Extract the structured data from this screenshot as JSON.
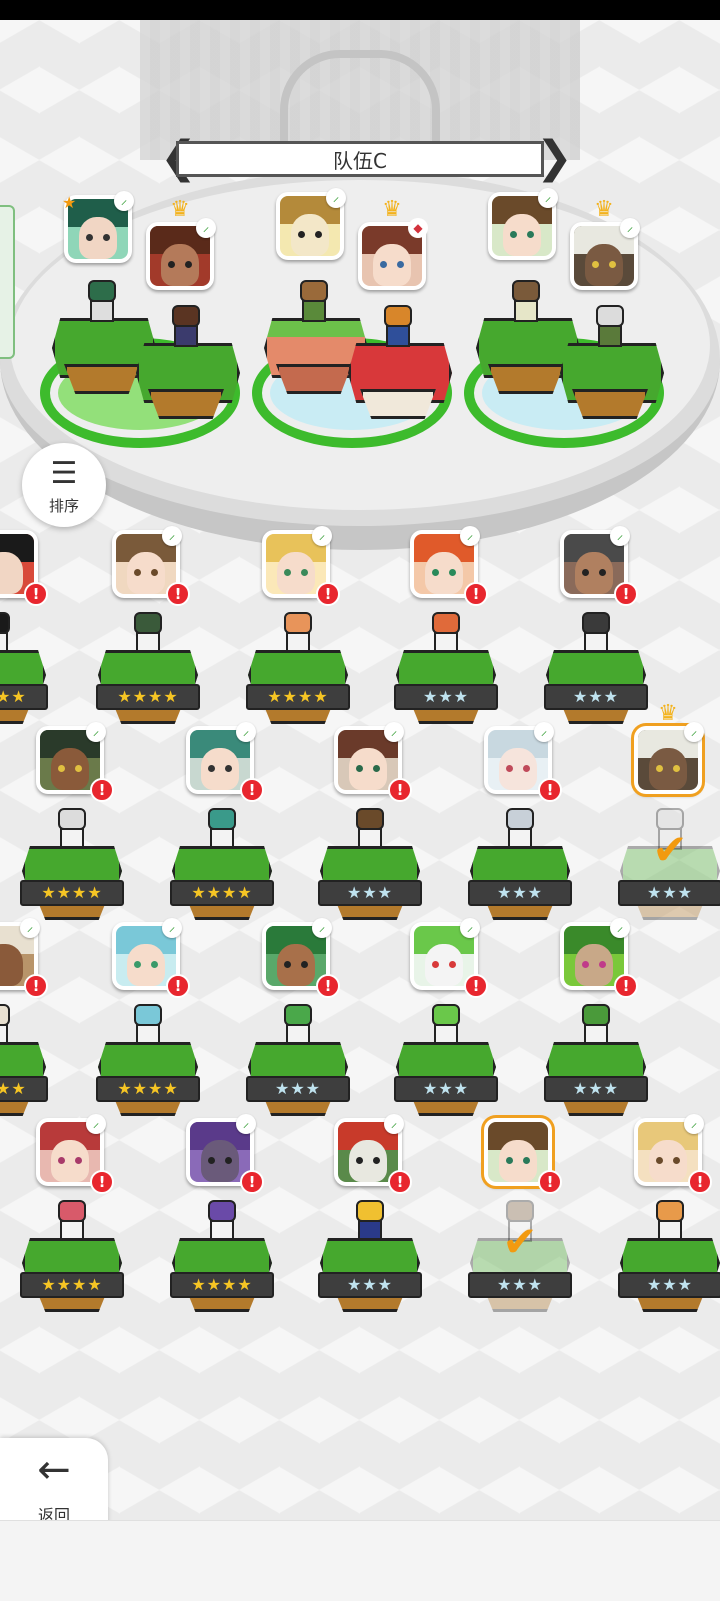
{
  "team": {
    "name": "队伍C"
  },
  "buttons": {
    "sort_label": "排序",
    "back_label": "返回"
  },
  "colors": {
    "crown": "#f3b21c",
    "alert": "#e8262e",
    "gold_star": "#f6c524",
    "silver_star": "#bfe2ee",
    "selection": "#f0a020",
    "grass": "#46a82e"
  },
  "icons": {
    "sort": "sort-descending-icon",
    "back": "arrow-left-icon",
    "leaf": "leaf-icon",
    "alert": "exclamation-badge-icon",
    "crown": "crown-icon",
    "check": "checkmark-icon"
  },
  "labels": {
    "leaf": "⸝",
    "alert": "!",
    "crown": "♛",
    "star": "★",
    "element": "◆",
    "check": "✔",
    "prev": "❮",
    "next": "❯",
    "sort_glyph": "☰",
    "back_glyph": "←",
    "four_star": "★★★★",
    "three_star": "★★★"
  },
  "roster": {
    "row1": [
      "★★★★",
      "★★★★",
      "★★★★",
      "★★★",
      "★★★"
    ],
    "row2": [
      "★★★★",
      "★★★★",
      "★★★",
      "★★★",
      "★★★"
    ],
    "row3": [
      "★★★★",
      "★★★★",
      "★★★",
      "★★★",
      "★★★"
    ],
    "row4": [
      "★★★★",
      "★★★★",
      "★★★",
      "★★★",
      "★★★"
    ]
  }
}
